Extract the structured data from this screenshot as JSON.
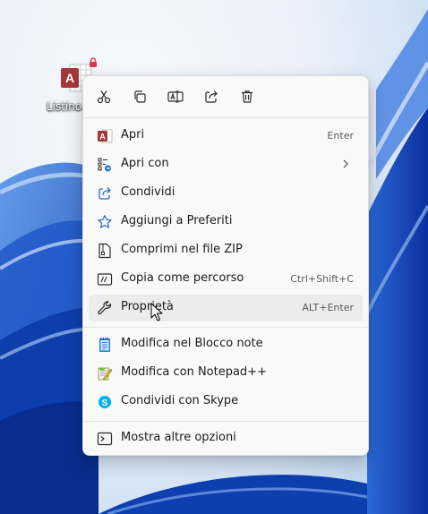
{
  "desktop": {
    "file_icon": {
      "name": "Listino.",
      "badge": "A"
    }
  },
  "context_menu": {
    "quick_actions": [
      {
        "name": "cut-icon"
      },
      {
        "name": "copy-icon"
      },
      {
        "name": "rename-icon"
      },
      {
        "name": "share-icon"
      },
      {
        "name": "delete-icon"
      }
    ],
    "items": [
      {
        "label": "Apri",
        "shortcut": "Enter",
        "icon": "access-icon"
      },
      {
        "label": "Apri con",
        "shortcut": "",
        "icon": "apps-icon",
        "submenu": true
      },
      {
        "label": "Condividi",
        "shortcut": "",
        "icon": "share-icon"
      },
      {
        "label": "Aggiungi a Preferiti",
        "shortcut": "",
        "icon": "star-icon"
      },
      {
        "label": "Comprimi nel file ZIP",
        "shortcut": "",
        "icon": "zip-icon"
      },
      {
        "label": "Copia come percorso",
        "shortcut": "Ctrl+Shift+C",
        "icon": "copy-path-icon"
      },
      {
        "label": "Proprietà",
        "shortcut": "ALT+Enter",
        "icon": "wrench-icon",
        "hovered": true
      },
      {
        "label": "Modifica nel Blocco note",
        "shortcut": "",
        "icon": "notepad-icon"
      },
      {
        "label": "Modifica con Notepad++",
        "shortcut": "",
        "icon": "notepadpp-icon"
      },
      {
        "label": "Condividi con Skype",
        "shortcut": "",
        "icon": "skype-icon"
      },
      {
        "label": "Mostra altre opzioni",
        "shortcut": "",
        "icon": "more-options-icon"
      }
    ]
  },
  "colors": {
    "access_red": "#a4373a",
    "icon_blue": "#1f6fc5",
    "menu_bg": "#f9f9f9",
    "hover_bg": "#ececec",
    "skype_blue": "#00aff0"
  }
}
